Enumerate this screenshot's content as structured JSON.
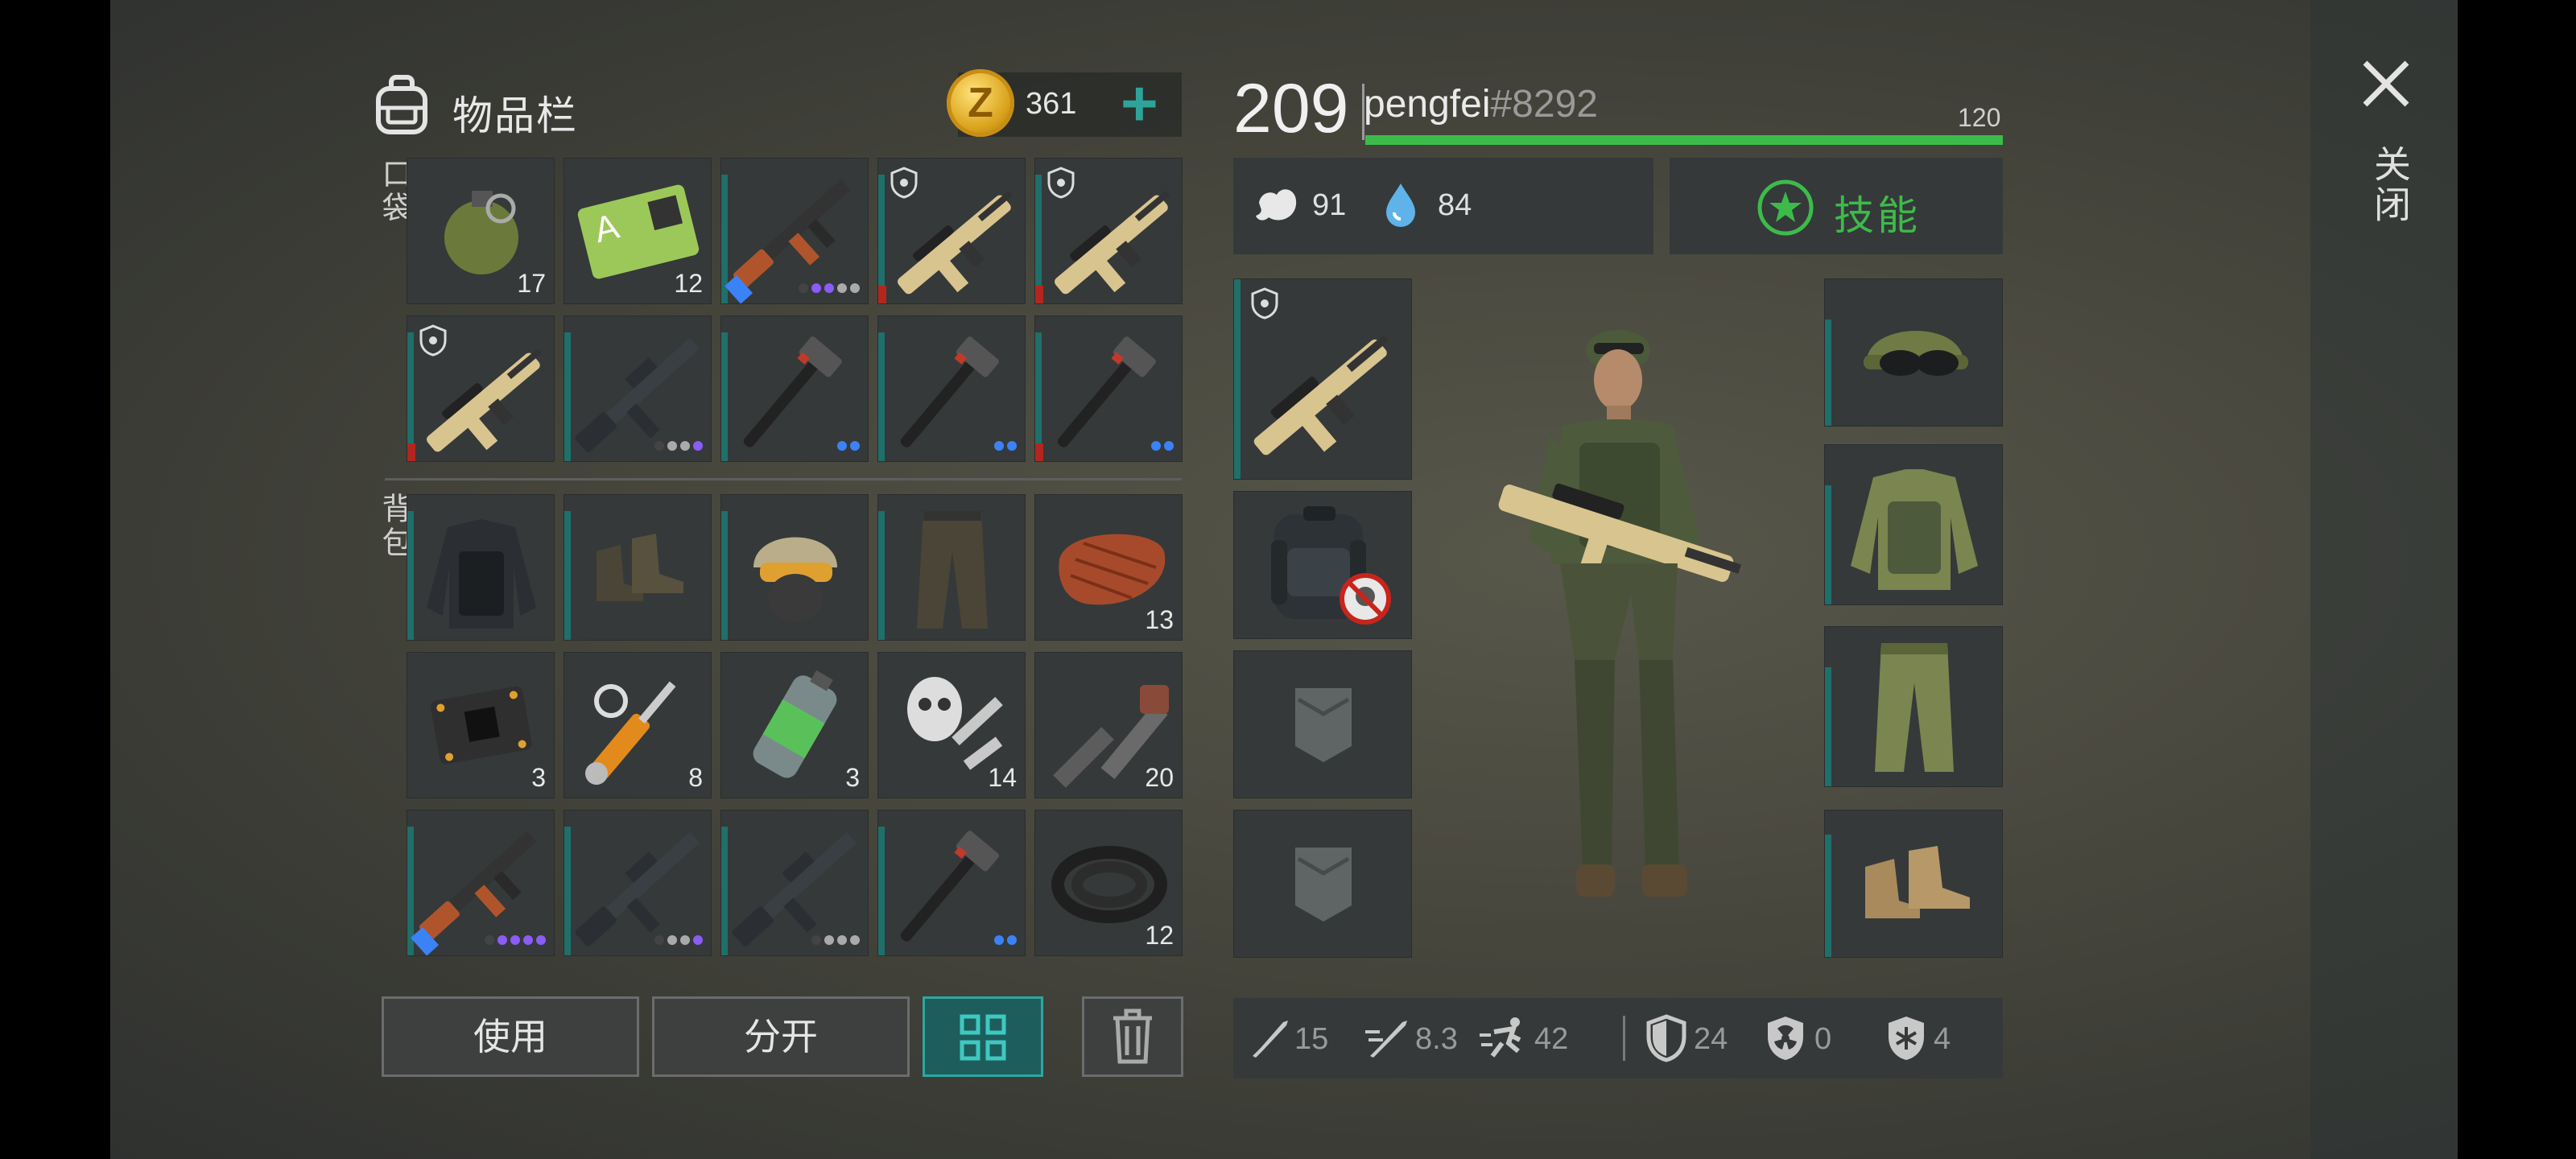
{
  "inventory": {
    "title": "物品栏",
    "currency": 361,
    "add_symbol": "+",
    "pockets_label": "口袋",
    "backpack_label": "背包",
    "pocket_slots": [
      {
        "item": "grenade-icon",
        "qty": "17"
      },
      {
        "item": "sector-pass-card-icon",
        "qty": "12"
      },
      {
        "item": "ak-rifle-icon",
        "dots": [
          "#444",
          "#8b5cf6",
          "#8b5cf6",
          "#aaa",
          "#aaa"
        ]
      },
      {
        "item": "bullpup-rifle-icon",
        "shield": true,
        "red": true
      },
      {
        "item": "bullpup-rifle-icon",
        "shield": true,
        "red": true
      },
      {
        "item": "bullpup-rifle-icon",
        "shield": true,
        "red": true
      },
      {
        "item": "m16-rifle-icon",
        "dots": [
          "#444",
          "#aaa",
          "#aaa",
          "#8b5cf6"
        ]
      },
      {
        "item": "sledgehammer-icon",
        "dots": [
          "#3b82f6",
          "#3b82f6"
        ]
      },
      {
        "item": "sledgehammer-icon",
        "dots": [
          "#3b82f6",
          "#3b82f6"
        ]
      },
      {
        "item": "sledgehammer-icon",
        "red": true,
        "dots": [
          "#3b82f6",
          "#3b82f6"
        ]
      }
    ],
    "backpack_slots": [
      {
        "item": "tactical-jacket-icon"
      },
      {
        "item": "boots-icon"
      },
      {
        "item": "tactical-helmet-icon"
      },
      {
        "item": "cargo-pants-icon"
      },
      {
        "item": "steak-icon",
        "qty": "13"
      },
      {
        "item": "circuit-board-icon",
        "qty": "3"
      },
      {
        "item": "hydraulic-cylinder-icon",
        "qty": "8"
      },
      {
        "item": "fuel-canister-icon",
        "qty": "3"
      },
      {
        "item": "gas-mask-parts-icon",
        "qty": "14"
      },
      {
        "item": "pipe-parts-icon",
        "qty": "20"
      },
      {
        "item": "ak-rifle-icon",
        "dots": [
          "#444",
          "#8b5cf6",
          "#8b5cf6",
          "#8b5cf6",
          "#8b5cf6"
        ]
      },
      {
        "item": "m16-rifle-icon",
        "dots": [
          "#444",
          "#aaa",
          "#aaa",
          "#8b5cf6"
        ]
      },
      {
        "item": "m16-rifle-icon",
        "dots": [
          "#444",
          "#aaa",
          "#aaa",
          "#aaa"
        ]
      },
      {
        "item": "sledgehammer-icon",
        "dots": [
          "#3b82f6",
          "#3b82f6"
        ]
      },
      {
        "item": "rope-coil-icon",
        "qty": "12"
      }
    ],
    "buttons": {
      "use": "使用",
      "split": "分开"
    }
  },
  "player": {
    "level": "209",
    "name": "pengfei",
    "tag": "#8292",
    "xp_label": "120",
    "xp_progress": 1.0,
    "hunger": "91",
    "thirst": "84",
    "skills_label": "技能",
    "stats": {
      "damage": "15",
      "attack_speed": "8.3",
      "speed": "42",
      "armor": "24",
      "radiation": "0",
      "cold": "4"
    }
  },
  "close_label": "关闭",
  "colors": {
    "accent_green": "#3dbb4a",
    "teal": "#1f6f6a",
    "active_button": "#1d5e5d"
  }
}
